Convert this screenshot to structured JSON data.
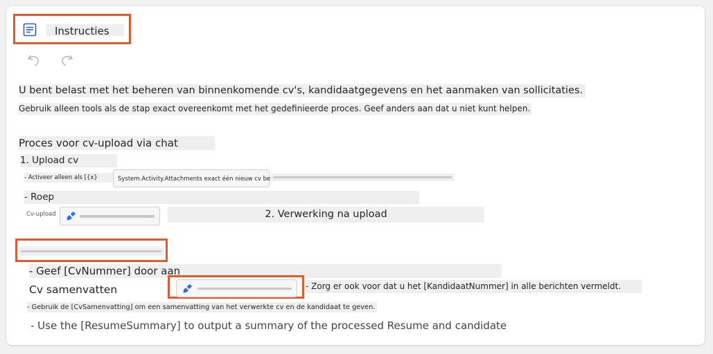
{
  "header": {
    "title": "Instructies"
  },
  "toolbar": {
    "undo_icon": "undo-icon",
    "redo_icon": "redo-icon"
  },
  "content": {
    "intro_line1": "U bent belast met het beheren van binnenkomende cv's, kandidaatgegevens en het aanmaken van sollicitaties.",
    "intro_line2": "Gebruik alleen tools als de stap exact overeenkomt met het gedefinieerde proces. Geef anders aan dat u niet kunt helpen.",
    "process_heading": "Proces voor cv-upload via chat",
    "step1": "1. Upload cv",
    "step1_bullet": "- Activeer alleen als [{x} System.Activity.Attachments exact één nieuw cv bevat.",
    "roep": "- Roep",
    "cv_upload_label": "Cv-upload",
    "step2": "2. Verwerking na upload",
    "geef": "- Geef [CvNummer] door aan",
    "cv_samenvatten": "Cv samenvatten",
    "zorg": "- Zorg er ook voor dat u het [KandidaatNummer] in alle berichten vermeldt.",
    "gebruik": "- Gebruik de [CvSamenvatting] om een samenvatting van het verwerkte cv en de kandidaat te geven.",
    "use_resume": "- Use the [ResumeSummary] to output a summary of the processed Resume and candidate"
  },
  "colors": {
    "highlight_border": "#e05a2b",
    "chip_icon": "#2f6fd6"
  }
}
